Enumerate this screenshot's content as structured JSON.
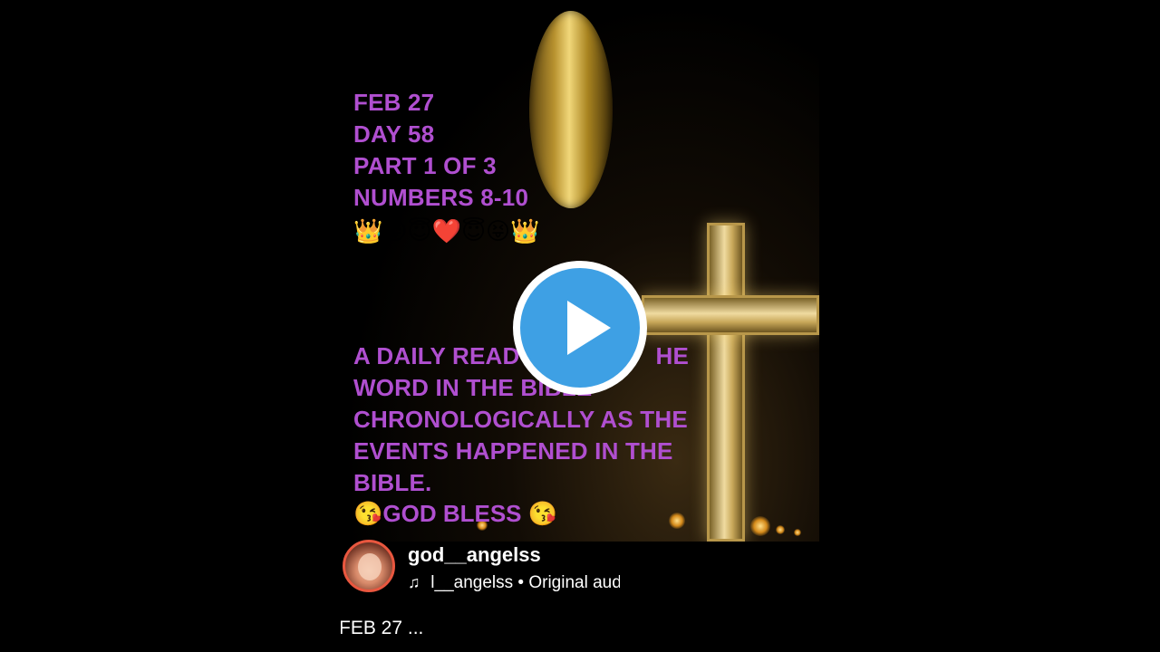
{
  "video": {
    "overlay_lines": [
      "FEB 27",
      "DAY 58",
      "PART 1 OF 3",
      "NUMBERS 8-10"
    ],
    "emoji_line": "👑😝😇❤️😇😝👑",
    "body_lines": [
      "A DAILY READ",
      "WORD IN THE BIBLE",
      "CHRONOLOGICALLY AS THE",
      "EVENTS HAPPENED IN THE",
      "BIBLE."
    ],
    "body_line1_tail": "HE",
    "bless_line": "😘GOD BLESS 😘",
    "play_icon": "play-icon"
  },
  "author": {
    "username": "god__angelss",
    "audio_text": "l__angelss • Original aud",
    "music_icon": "music-note-icon",
    "music_glyph": "♫"
  },
  "caption": {
    "text": "FEB 27 ..."
  },
  "colors": {
    "overlay_text": "#b04fd0",
    "play_button": "#3ea0e4",
    "avatar_ring": "#e9573f"
  }
}
